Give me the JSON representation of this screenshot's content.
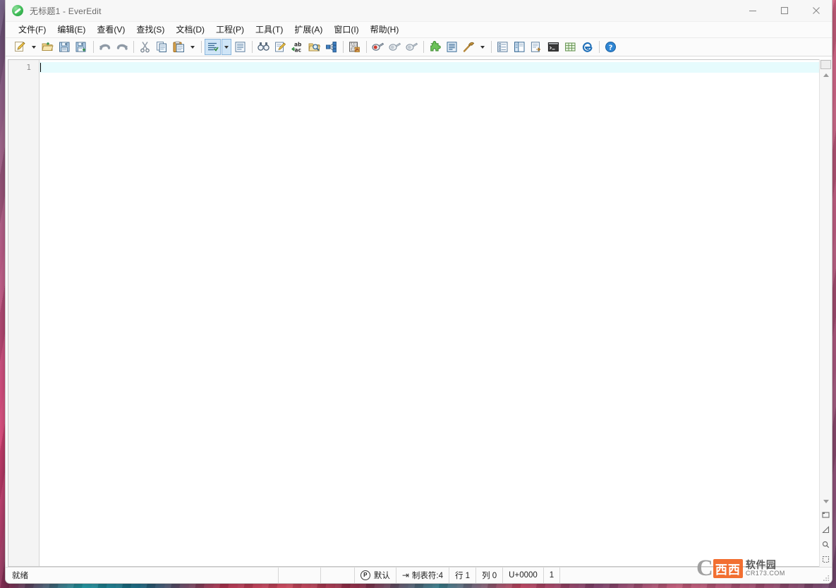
{
  "window": {
    "title": "无标题1 - EverEdit",
    "app_icon": "everedit-leaf-icon",
    "controls": {
      "minimize": "minimize-icon",
      "maximize": "maximize-icon",
      "close": "close-icon"
    }
  },
  "menubar": {
    "items": [
      {
        "label": "文件(F)",
        "name": "menu-file"
      },
      {
        "label": "编辑(E)",
        "name": "menu-edit"
      },
      {
        "label": "查看(V)",
        "name": "menu-view"
      },
      {
        "label": "查找(S)",
        "name": "menu-search"
      },
      {
        "label": "文档(D)",
        "name": "menu-document"
      },
      {
        "label": "工程(P)",
        "name": "menu-project"
      },
      {
        "label": "工具(T)",
        "name": "menu-tools"
      },
      {
        "label": "扩展(A)",
        "name": "menu-addons"
      },
      {
        "label": "窗口(I)",
        "name": "menu-window"
      },
      {
        "label": "帮助(H)",
        "name": "menu-help"
      }
    ]
  },
  "toolbar": {
    "buttons": [
      {
        "name": "new-file-icon",
        "title": "新建"
      },
      {
        "name": "new-file-dropdown-icon",
        "title": "新建下拉"
      },
      {
        "name": "open-file-icon",
        "title": "打开"
      },
      {
        "name": "save-icon",
        "title": "保存"
      },
      {
        "name": "save-all-icon",
        "title": "全部保存"
      },
      {
        "name": "undo-icon",
        "title": "撤销"
      },
      {
        "name": "redo-icon",
        "title": "重做"
      },
      {
        "name": "cut-icon",
        "title": "剪切"
      },
      {
        "name": "copy-icon",
        "title": "复制"
      },
      {
        "name": "paste-icon",
        "title": "粘贴"
      },
      {
        "name": "paste-dropdown-icon",
        "title": "粘贴下拉"
      },
      {
        "name": "indent-guide-icon",
        "title": "显示符号",
        "active": true
      },
      {
        "name": "indent-guide-dropdown-icon",
        "title": "显示符号下拉",
        "active": true
      },
      {
        "name": "word-wrap-icon",
        "title": "自动换行"
      },
      {
        "name": "find-icon",
        "title": "查找"
      },
      {
        "name": "replace-icon",
        "title": "替换"
      },
      {
        "name": "replace-all-icon",
        "title": "全部替换"
      },
      {
        "name": "find-in-files-icon",
        "title": "在文件中查找"
      },
      {
        "name": "code-map-icon",
        "title": "结构图"
      },
      {
        "name": "hex-view-icon",
        "title": "十六进制"
      },
      {
        "name": "bookmark-toggle-icon",
        "title": "切换书签"
      },
      {
        "name": "bookmark-prev-icon",
        "title": "上一个书签"
      },
      {
        "name": "bookmark-next-icon",
        "title": "下一个书签"
      },
      {
        "name": "plugin-icon",
        "title": "插件"
      },
      {
        "name": "snippet-icon",
        "title": "代码片段"
      },
      {
        "name": "build-icon",
        "title": "编译运行"
      },
      {
        "name": "build-dropdown-icon",
        "title": "编译运行下拉"
      },
      {
        "name": "symbol-list-icon",
        "title": "符号列表"
      },
      {
        "name": "project-panel-icon",
        "title": "工程面板"
      },
      {
        "name": "output-panel-icon",
        "title": "输出面板"
      },
      {
        "name": "console-icon",
        "title": "命令行"
      },
      {
        "name": "grid-icon",
        "title": "表格"
      },
      {
        "name": "browser-preview-icon",
        "title": "浏览器预览"
      },
      {
        "name": "help-icon",
        "title": "帮助"
      }
    ]
  },
  "editor": {
    "line_numbers": [
      "1"
    ],
    "content": "",
    "scrollbar": {
      "up_arrow": "scroll-up-icon",
      "down_arrow": "scroll-down-icon",
      "extra_icons": [
        "document-map-icon",
        "ruler-icon",
        "zoom-icon",
        "select-block-icon"
      ]
    }
  },
  "statusbar": {
    "ready": "就绪",
    "profile_icon": "profile-p-icon",
    "profile": "默认",
    "tab_icon": "tab-arrow-icon",
    "tab_width": "制表符:4",
    "line": "行 1",
    "column": "列 0",
    "unicode": "U+0000",
    "encoding_index": "1"
  },
  "watermark": {
    "c_letter": "C",
    "badge": "西西",
    "cn": "软件园",
    "url": "CR173.COM"
  },
  "colors": {
    "accent": "#cfe5f7",
    "current_line": "#e6fbfd",
    "window_bg": "#f0f0f0",
    "gutter": "#f4f4f4",
    "brand_orange": "#f26522"
  }
}
